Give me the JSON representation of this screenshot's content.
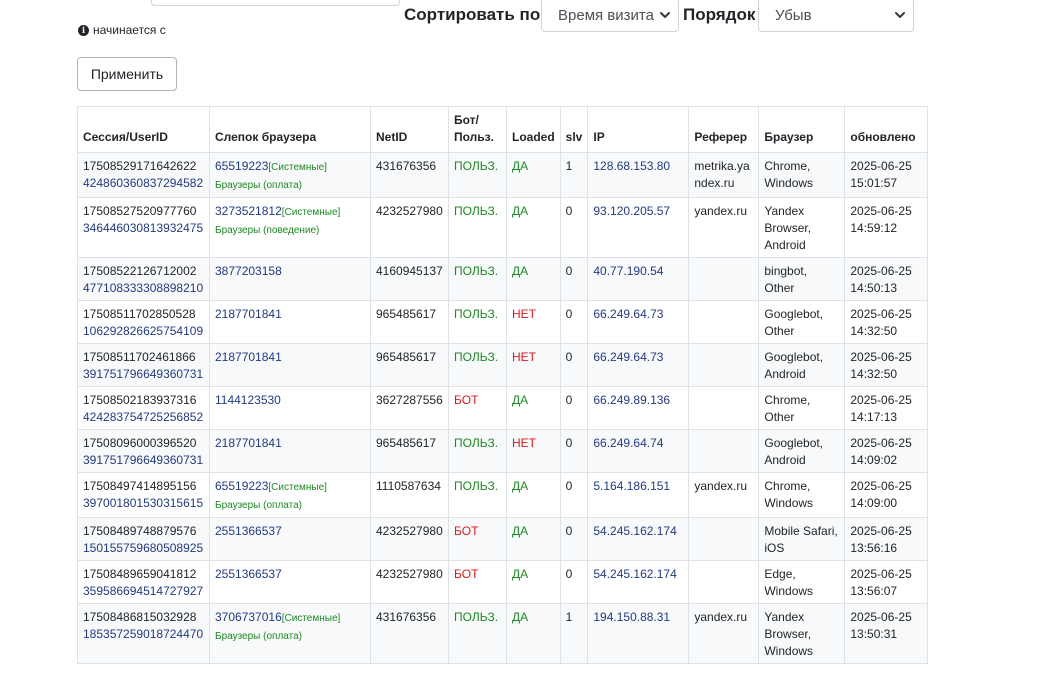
{
  "filter": {
    "hint": "начинается с"
  },
  "sort": {
    "label": "Сортировать по:",
    "value": "Время визита",
    "order_label": "Порядок",
    "order_value": "Убыв"
  },
  "apply_label": "Применить",
  "table": {
    "headers": {
      "session": "Сессия/UserID",
      "fingerprint": "Слепок браузера",
      "netid": "NetID",
      "bot_line1": "Бот/",
      "bot_line2": "Польз.",
      "loaded": "Loaded",
      "slv": "slv",
      "ip": "IP",
      "referer": "Реферер",
      "browser": "Браузер",
      "updated": "обновлено"
    },
    "rows": [
      {
        "session": "17508529171642622",
        "userid": "424860360837294582",
        "fp": "65519223",
        "fp_tag": "[Системные]",
        "fp_sub": "Браузеры (оплата)",
        "netid": "431676356",
        "bot": "ПОЛЬЗ.",
        "loaded": "ДА",
        "slv": "1",
        "ip": "128.68.153.80",
        "referer_1": "metrika.ya",
        "referer_2": "ndex.ru",
        "browser_1": "Chrome,",
        "browser_2": "Windows",
        "browser_3": "",
        "date": "2025-06-25",
        "time": "15:01:57"
      },
      {
        "session": "17508527520977760",
        "userid": "346446030813932475",
        "fp": "3273521812",
        "fp_tag": "[Системные]",
        "fp_sub": "Браузеры (поведение)",
        "netid": "4232527980",
        "bot": "ПОЛЬЗ.",
        "loaded": "ДА",
        "slv": "0",
        "ip": "93.120.205.57",
        "referer_1": "yandex.ru",
        "referer_2": "",
        "browser_1": "Yandex",
        "browser_2": "Browser,",
        "browser_3": "Android",
        "date": "2025-06-25",
        "time": "14:59:12"
      },
      {
        "session": "17508522126712002",
        "userid": "477108333308898210",
        "fp": "3877203158",
        "fp_tag": "",
        "fp_sub": "",
        "netid": "4160945137",
        "bot": "ПОЛЬЗ.",
        "loaded": "ДА",
        "slv": "0",
        "ip": "40.77.190.54",
        "referer_1": "",
        "referer_2": "",
        "browser_1": "bingbot, Other",
        "browser_2": "",
        "browser_3": "",
        "date": "2025-06-25",
        "time": "14:50:13"
      },
      {
        "session": "17508511702850528",
        "userid": "106292826625754109",
        "fp": "2187701841",
        "fp_tag": "",
        "fp_sub": "",
        "netid": "965485617",
        "bot": "ПОЛЬЗ.",
        "loaded": "НЕТ",
        "slv": "0",
        "ip": "66.249.64.73",
        "referer_1": "",
        "referer_2": "",
        "browser_1": "Googlebot,",
        "browser_2": "Other",
        "browser_3": "",
        "date": "2025-06-25",
        "time": "14:32:50"
      },
      {
        "session": "17508511702461866",
        "userid": "391751796649360731",
        "fp": "2187701841",
        "fp_tag": "",
        "fp_sub": "",
        "netid": "965485617",
        "bot": "ПОЛЬЗ.",
        "loaded": "НЕТ",
        "slv": "0",
        "ip": "66.249.64.73",
        "referer_1": "",
        "referer_2": "",
        "browser_1": "Googlebot,",
        "browser_2": "Android",
        "browser_3": "",
        "date": "2025-06-25",
        "time": "14:32:50"
      },
      {
        "session": "17508502183937316",
        "userid": "424283754725256852",
        "fp": "1144123530",
        "fp_tag": "",
        "fp_sub": "",
        "netid": "3627287556",
        "bot": "БОТ",
        "loaded": "ДА",
        "slv": "0",
        "ip": "66.249.89.136",
        "referer_1": "",
        "referer_2": "",
        "browser_1": "Chrome,",
        "browser_2": "Other",
        "browser_3": "",
        "date": "2025-06-25",
        "time": "14:17:13"
      },
      {
        "session": "17508096000396520",
        "userid": "391751796649360731",
        "fp": "2187701841",
        "fp_tag": "",
        "fp_sub": "",
        "netid": "965485617",
        "bot": "ПОЛЬЗ.",
        "loaded": "НЕТ",
        "slv": "0",
        "ip": "66.249.64.74",
        "referer_1": "",
        "referer_2": "",
        "browser_1": "Googlebot,",
        "browser_2": "Android",
        "browser_3": "",
        "date": "2025-06-25",
        "time": "14:09:02"
      },
      {
        "session": "17508497414895156",
        "userid": "397001801530315615",
        "fp": "65519223",
        "fp_tag": "[Системные]",
        "fp_sub": "Браузеры (оплата)",
        "netid": "1110587634",
        "bot": "ПОЛЬЗ.",
        "loaded": "ДА",
        "slv": "0",
        "ip": "5.164.186.151",
        "referer_1": "yandex.ru",
        "referer_2": "",
        "browser_1": "Chrome,",
        "browser_2": "Windows",
        "browser_3": "",
        "date": "2025-06-25",
        "time": "14:09:00"
      },
      {
        "session": "17508489748879576",
        "userid": "150155759680508925",
        "fp": "2551366537",
        "fp_tag": "",
        "fp_sub": "",
        "netid": "4232527980",
        "bot": "БОТ",
        "loaded": "ДА",
        "slv": "0",
        "ip": "54.245.162.174",
        "referer_1": "",
        "referer_2": "",
        "browser_1": "Mobile Safari,",
        "browser_2": "iOS",
        "browser_3": "",
        "date": "2025-06-25",
        "time": "13:56:16"
      },
      {
        "session": "17508489659041812",
        "userid": "359586694514727927",
        "fp": "2551366537",
        "fp_tag": "",
        "fp_sub": "",
        "netid": "4232527980",
        "bot": "БОТ",
        "loaded": "ДА",
        "slv": "0",
        "ip": "54.245.162.174",
        "referer_1": "",
        "referer_2": "",
        "browser_1": "Edge,",
        "browser_2": "Windows",
        "browser_3": "",
        "date": "2025-06-25",
        "time": "13:56:07"
      },
      {
        "session": "17508486815032928",
        "userid": "185357259018724470",
        "fp": "3706737016",
        "fp_tag": "[Системные]",
        "fp_sub": "Браузеры (оплата)",
        "netid": "431676356",
        "bot": "ПОЛЬЗ.",
        "loaded": "ДА",
        "slv": "1",
        "ip": "194.150.88.31",
        "referer_1": "yandex.ru",
        "referer_2": "",
        "browser_1": "Yandex",
        "browser_2": "Browser,",
        "browser_3": "Windows",
        "date": "2025-06-25",
        "time": "13:50:31"
      }
    ]
  }
}
